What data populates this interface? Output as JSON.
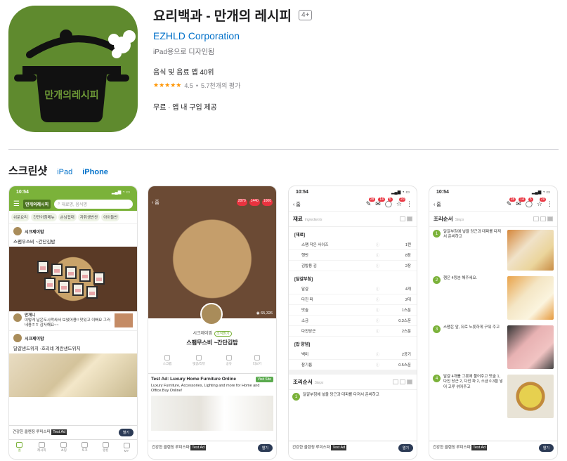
{
  "header": {
    "title": "요리백과 - 만개의 레시피",
    "age_rating": "4+",
    "developer": "EZHLD Corporation",
    "designed_for": "iPad용으로 디자인됨",
    "rank": "음식 및 음료 앱 40위",
    "stars": "★★★★★",
    "rating": "4.5",
    "rating_count": "5.7천개의 평가",
    "price": "무료 · 앱 내 구입 제공"
  },
  "screenshots_section": {
    "title": "스크린샷",
    "tabs": [
      "iPad",
      "iPhone"
    ],
    "active_tab": "iPhone"
  },
  "shot1": {
    "time": "10:54",
    "logo": "만개의레시피",
    "search_placeholder": "재료명, 음식명",
    "categories": [
      "쉬운요리",
      "간단아침메뉴",
      "손님접대",
      "자취생반찬",
      "아이들반"
    ],
    "author1": "시크제이맘",
    "post1_title": "스팸무스비 ~간단김밥",
    "commenter": "만개니",
    "comment": "이렇게 날은도시락싸서 보냈어용!! 맛있고 이뻐요 그러네용ㅎㅎ 감사해요~~",
    "author2": "시크제이맘",
    "post2_title": "달걀샌드위치 -호리네 계란샌드위치",
    "ad_text": "건강한 클렌징 루미스파",
    "ad_label": "Test Ad",
    "ad_button": "열기",
    "tabbar": [
      "홈",
      "레시피",
      "쇼핑",
      "토크",
      "랭킹",
      "MY"
    ]
  },
  "shot2": {
    "back": "홈",
    "badges": [
      "2870",
      "1440",
      "1000"
    ],
    "views": "65,326",
    "author": "시크제이맘",
    "follow": "소식받기",
    "title": "스팸무스비 ~간단김밥",
    "actions": [
      "스크랩",
      "댓글/리뷰",
      "공유",
      "더보기"
    ],
    "ad_title": "Test Ad: Luxury Home Furniture Online",
    "ad_button": "Visit Site",
    "ad_body": "Luxury Furniture, Accessories, Lighting and more for Home and Office.Buy Online!",
    "ad_text": "건강한 클렌징 루미스파",
    "ad_label": "Test Ad",
    "ad_open": "열기"
  },
  "shot3": {
    "time": "10:54",
    "back": "홈",
    "badges": [
      "28",
      "14",
      "5",
      "20"
    ],
    "ingredients_title": "재료",
    "ingredients_sub": "Ingredients",
    "group1": "[재료]",
    "items1": [
      {
        "name": "스팸 작은 사이즈",
        "amt": "1캔"
      },
      {
        "name": "햇반",
        "amt": "8장"
      },
      {
        "name": "김밥용 김",
        "amt": "2장"
      }
    ],
    "group2": "[달걀부침]",
    "items2": [
      {
        "name": "달걀",
        "amt": "4개"
      },
      {
        "name": "다진 파",
        "amt": "2대"
      },
      {
        "name": "맛술",
        "amt": "1스푼"
      },
      {
        "name": "소금",
        "amt": "0.3스푼"
      },
      {
        "name": "다진당근",
        "amt": "2스푼"
      }
    ],
    "group3": "[밥 양념]",
    "items3": [
      {
        "name": "백미",
        "amt": "2공기"
      },
      {
        "name": "참기름",
        "amt": "0.5스푼"
      }
    ],
    "steps_title": "조리순서",
    "steps_sub": "Steps",
    "step1": "달걀부침에 넣을 당근과 대파를 다져서 준비하고",
    "ad_text": "건강한 클렌징 루미스파",
    "ad_label": "Test Ad",
    "ad_button": "열기"
  },
  "shot4": {
    "time": "10:54",
    "back": "홈",
    "steps_title": "조리순서",
    "steps_sub": "Steps",
    "steps": [
      {
        "num": "1",
        "text": "달걀부침에 넣을 당근과 대파를 다져서 준비하고"
      },
      {
        "num": "2",
        "text": "햄은 4등분 해주세요."
      },
      {
        "num": "3",
        "text": "스팸은 앞, 뒤로 노릇하게 구워 주고"
      },
      {
        "num": "4",
        "text": "달걀 4개를 그릇에 풀어주고 맛술 1, 다진 당근 2, 다진 파 2, 소금 0.3을 넣어 고루 섞어주고"
      }
    ],
    "ad_text": "건강한 클렌징 루미스파",
    "ad_label": "Test Ad",
    "ad_button": "열기"
  },
  "colors": {
    "brand_green": "#7bb23a",
    "link_blue": "#0070c9",
    "icon_bg": "#5f8a2e",
    "badge_red": "#e9333f"
  },
  "icons": [
    "pot-logo-icon",
    "search-icon",
    "menu-icon",
    "back-icon",
    "bookmark-icon",
    "comment-icon",
    "star-icon",
    "more-icon"
  ]
}
